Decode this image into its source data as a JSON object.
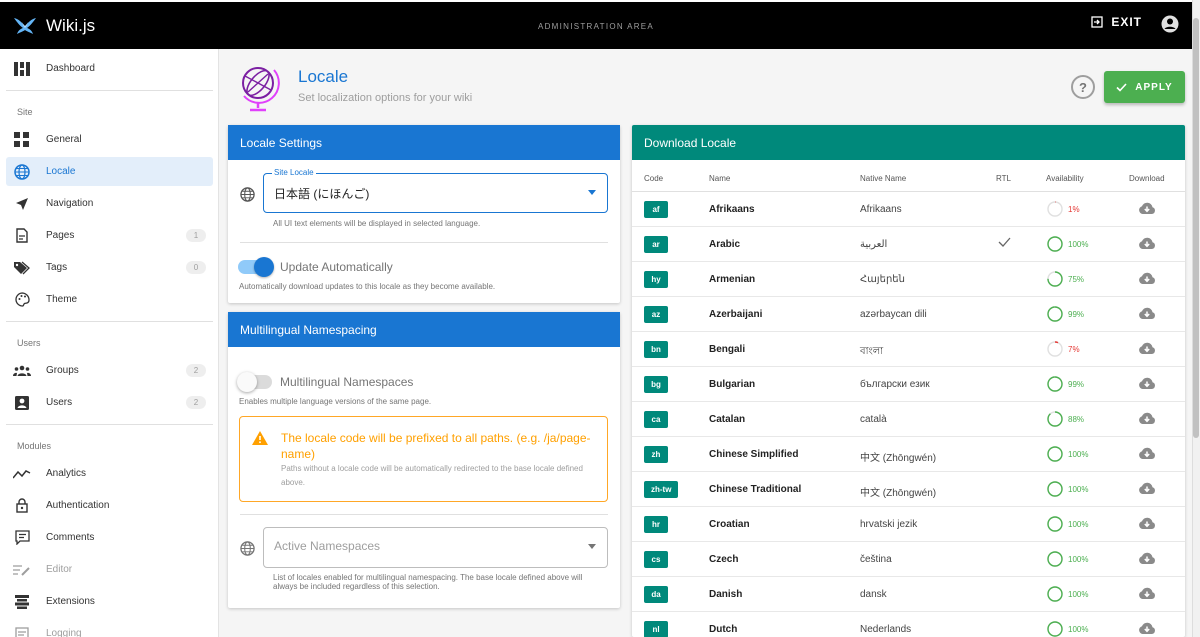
{
  "app": {
    "name": "Wiki.js",
    "area_title": "ADMINISTRATION AREA",
    "exit_label": "EXIT"
  },
  "sidebar": {
    "items": [
      {
        "label": "Dashboard"
      },
      {
        "section": "Site"
      },
      {
        "label": "General"
      },
      {
        "label": "Locale"
      },
      {
        "label": "Navigation"
      },
      {
        "label": "Pages",
        "badge": "1"
      },
      {
        "label": "Tags",
        "badge": "0"
      },
      {
        "label": "Theme"
      },
      {
        "section": "Users"
      },
      {
        "label": "Groups",
        "badge": "2"
      },
      {
        "label": "Users",
        "badge": "2"
      },
      {
        "section": "Modules"
      },
      {
        "label": "Analytics"
      },
      {
        "label": "Authentication"
      },
      {
        "label": "Comments"
      },
      {
        "label": "Editor"
      },
      {
        "label": "Extensions"
      },
      {
        "label": "Logging"
      }
    ]
  },
  "header": {
    "title": "Locale",
    "subtitle": "Set localization options for your wiki",
    "help": "?",
    "apply_label": "APPLY"
  },
  "locale_settings": {
    "title": "Locale Settings",
    "site_locale_label": "Site Locale",
    "site_locale_value": "日本語 (にほんご)",
    "site_locale_hint": "All UI text elements will be displayed in selected language.",
    "update_auto_label": "Update Automatically",
    "update_auto_on": true,
    "update_auto_hint": "Automatically download updates to this locale as they become available."
  },
  "namespacing": {
    "title": "Multilingual Namespacing",
    "toggle_label": "Multilingual Namespaces",
    "toggle_on": false,
    "toggle_hint": "Enables multiple language versions of the same page.",
    "alert_title": "The locale code will be prefixed to all paths. (e.g. /ja/page-name)",
    "alert_text": "Paths without a locale code will be automatically redirected to the base locale defined above.",
    "active_placeholder": "Active Namespaces",
    "active_hint": "List of locales enabled for multilingual namespacing. The base locale defined above will always be included regardless of this selection."
  },
  "download": {
    "title": "Download Locale",
    "headers": {
      "code": "Code",
      "name": "Name",
      "native": "Native Name",
      "rtl": "RTL",
      "availability": "Availability",
      "download": "Download"
    },
    "rows": [
      {
        "code": "af",
        "name": "Afrikaans",
        "native": "Afrikaans",
        "rtl": false,
        "availability": 1
      },
      {
        "code": "ar",
        "name": "Arabic",
        "native": "العربية",
        "rtl": true,
        "availability": 100
      },
      {
        "code": "hy",
        "name": "Armenian",
        "native": "Հայերեն",
        "rtl": false,
        "availability": 75
      },
      {
        "code": "az",
        "name": "Azerbaijani",
        "native": "azərbaycan dili",
        "rtl": false,
        "availability": 99
      },
      {
        "code": "bn",
        "name": "Bengali",
        "native": "বাংলা",
        "rtl": false,
        "availability": 7
      },
      {
        "code": "bg",
        "name": "Bulgarian",
        "native": "български език",
        "rtl": false,
        "availability": 99
      },
      {
        "code": "ca",
        "name": "Catalan",
        "native": "català",
        "rtl": false,
        "availability": 88
      },
      {
        "code": "zh",
        "name": "Chinese Simplified",
        "native": "中文 (Zhōngwén)",
        "rtl": false,
        "availability": 100
      },
      {
        "code": "zh-tw",
        "name": "Chinese Traditional",
        "native": "中文 (Zhōngwén)",
        "rtl": false,
        "availability": 100
      },
      {
        "code": "hr",
        "name": "Croatian",
        "native": "hrvatski jezik",
        "rtl": false,
        "availability": 100
      },
      {
        "code": "cs",
        "name": "Czech",
        "native": "čeština",
        "rtl": false,
        "availability": 100
      },
      {
        "code": "da",
        "name": "Danish",
        "native": "dansk",
        "rtl": false,
        "availability": 100
      },
      {
        "code": "nl",
        "name": "Dutch",
        "native": "Nederlands",
        "rtl": false,
        "availability": 100
      }
    ]
  },
  "colors": {
    "primary": "#1976d2",
    "teal": "#00897b",
    "success": "#4caf50",
    "warning": "#ffa000",
    "danger": "#e53935"
  },
  "icons": {
    "brand": "wikijs-logo-icon",
    "exit": "exit-icon",
    "account": "account-circle-icon",
    "page": "globe-stand-icon",
    "help": "help-circle-icon",
    "apply": "check-icon",
    "download": "cloud-download-icon",
    "rtl": "check-icon"
  }
}
